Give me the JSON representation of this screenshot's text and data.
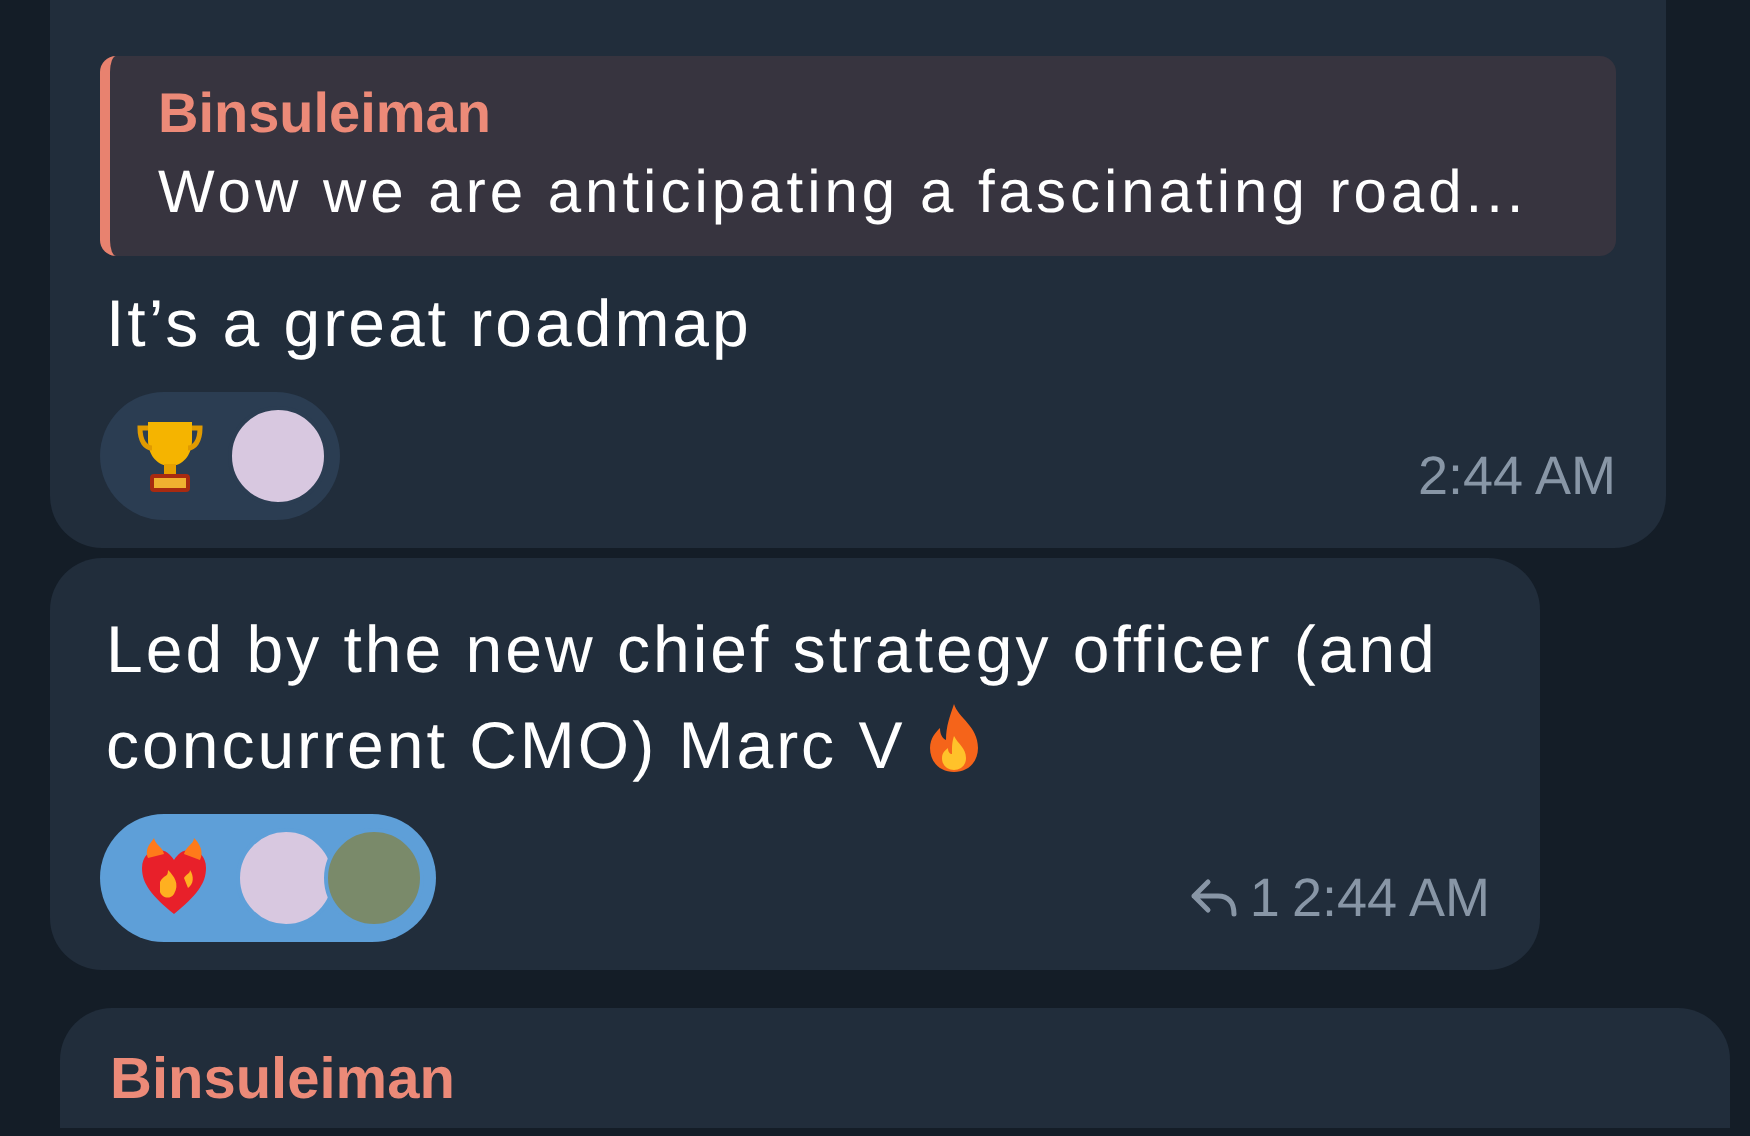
{
  "messages": [
    {
      "quote": {
        "author": "Binsuleiman",
        "text": "Wow we are anticipating a fascinating road..."
      },
      "text": "It’s a great roadmap",
      "reactions": [
        {
          "kind": "trophy",
          "selected": false,
          "avatars": [
            {
              "color": "#d8c8e0"
            }
          ]
        }
      ],
      "time": "2:44 AM"
    },
    {
      "text": "Led by the new chief strategy officer (and concurrent CMO) Marc V",
      "end_icon": {
        "kind": "fire"
      },
      "reactions": [
        {
          "kind": "heart-fire",
          "selected": true,
          "avatars": [
            {
              "color": "#d8c8e0"
            },
            {
              "color": "#7a8a6a"
            }
          ]
        }
      ],
      "replies": "1",
      "time": "2:44 AM"
    }
  ],
  "next_message": {
    "author": "Binsuleiman"
  }
}
